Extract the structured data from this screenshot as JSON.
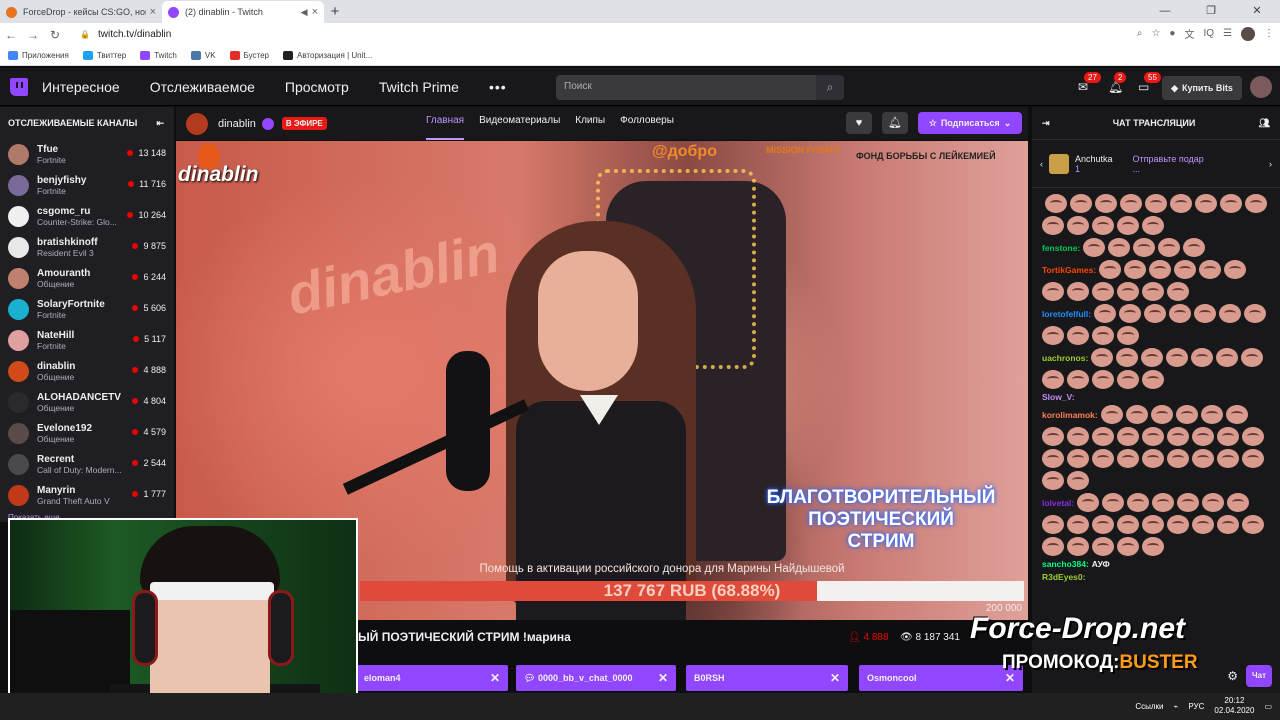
{
  "browser": {
    "tabs": [
      {
        "title": "ForceDrop - кейсы CS:GO, новы",
        "active": false,
        "color": "#e8731f"
      },
      {
        "title": "(2) dinablin - Twitch",
        "active": true,
        "color": "#9147ff"
      }
    ],
    "url": "twitch.tv/dinablin",
    "bookmarks": [
      {
        "label": "Приложения",
        "color": "#4285f4"
      },
      {
        "label": "Твиттер",
        "color": "#1da1f2"
      },
      {
        "label": "Twitch",
        "color": "#9147ff"
      },
      {
        "label": "VK",
        "color": "#4a76a8"
      },
      {
        "label": "Бустер",
        "color": "#e52d27"
      },
      {
        "label": "Авторизация | Unit...",
        "color": "#222222"
      }
    ]
  },
  "nav": {
    "links": [
      "Интересное",
      "Отслеживаемое",
      "Просмотр",
      "Twitch Prime"
    ],
    "search_placeholder": "Поиск",
    "badges": {
      "inbox": "27",
      "notifications": "2",
      "whispers": "55"
    },
    "bits_label": "Купить Bits"
  },
  "sidebar": {
    "title": "ОТСЛЕЖИВАЕМЫЕ КАНАЛЫ",
    "items": [
      {
        "name": "Tfue",
        "game": "Fortnite",
        "viewers": "13 148",
        "color": "#b07a6a"
      },
      {
        "name": "benjyfishy",
        "game": "Fortnite",
        "viewers": "11 716",
        "color": "#7a6a9a"
      },
      {
        "name": "csgomc_ru",
        "game": "Counter-Strike: Glo...",
        "viewers": "10 264",
        "color": "#f0f0f0"
      },
      {
        "name": "bratishkinoff",
        "game": "Resident Evil 3",
        "viewers": "9 875",
        "color": "#e8e8e8"
      },
      {
        "name": "Amouranth",
        "game": "Общение",
        "viewers": "6 244",
        "color": "#c08070"
      },
      {
        "name": "SolaryFortnite",
        "game": "Fortnite",
        "viewers": "5 606",
        "color": "#1ab0d0"
      },
      {
        "name": "NateHill",
        "game": "Fortnite",
        "viewers": "5 117",
        "color": "#e0a0a0"
      },
      {
        "name": "dinablin",
        "game": "Общение",
        "viewers": "4 888",
        "color": "#d04a1a"
      },
      {
        "name": "ALOHADANCETV",
        "game": "Общение",
        "viewers": "4 804",
        "color": "#2a2a2a"
      },
      {
        "name": "Evelone192",
        "game": "Общение",
        "viewers": "4 579",
        "color": "#5a4a4a"
      },
      {
        "name": "Recrent",
        "game": "Call of Duty: Modern...",
        "viewers": "2 544",
        "color": "#4a4a4a"
      },
      {
        "name": "Manyrin",
        "game": "Grand Theft Auto V",
        "viewers": "1 777",
        "color": "#c03a1a"
      }
    ],
    "more": "Показать еще"
  },
  "channel": {
    "name": "dinablin",
    "live_label": "В ЭФИРЕ",
    "tabs": [
      "Главная",
      "Видеоматериалы",
      "Клипы",
      "Фолловеры"
    ],
    "subscribe_label": "Подписаться"
  },
  "video": {
    "logo_text": "dinablin",
    "sponsor1": "@добро",
    "sponsor2": "MISSION POINTS",
    "sponsor3": "ФОНД БОРЬБЫ С ЛЕЙКЕМИЕЙ",
    "neon_text": "dinablin",
    "charity_lines": [
      "БЛАГОТВОРИТЕЛЬНЫЙ",
      "ПОЭТИЧЕСКИЙ",
      "СТРИМ"
    ],
    "help_text": "Помощь в активации российского донора для Марины Найдышевой",
    "raised": "137 767 RUB (68.88%)",
    "progress_fraction": 0.6888,
    "goal": "200 000"
  },
  "stream": {
    "title": "ЫЙ ПОЭТИЧЕСКИЙ СТРИМ !марина",
    "viewers": "4 888",
    "total_views": "8 187 341"
  },
  "tags": [
    "eloman4",
    "0000_bb_v_chat_0000",
    "B0RSH",
    "Osmoncool"
  ],
  "chat": {
    "title": "ЧАТ ТРАНСЛЯЦИИ",
    "gift_user": "Anchutka",
    "gift_count": "1",
    "gift_text": "Отправьте подар",
    "gift_more": "...",
    "messages": [
      {
        "user": "",
        "color": "#efeff1",
        "emotes": 14,
        "text": ""
      },
      {
        "user": "fenstone:",
        "color": "#00c853",
        "emotes": 5,
        "text": ""
      },
      {
        "user": "TortikGames:",
        "color": "#ff4500",
        "emotes": 12,
        "text": ""
      },
      {
        "user": "loretofelfull:",
        "color": "#1e90ff",
        "emotes": 11,
        "text": ""
      },
      {
        "user": "uachronos:",
        "color": "#9acd32",
        "emotes": 12,
        "text": ""
      },
      {
        "user": "Slow_V:",
        "color": "#c08ff0",
        "emotes": 0,
        "text": ""
      },
      {
        "user": "korolimamok:",
        "color": "#ff7f50",
        "emotes": 26,
        "text": ""
      },
      {
        "user": "lolvetal:",
        "color": "#8a2be2",
        "emotes": 21,
        "text": ""
      },
      {
        "user": "sancho384:",
        "color": "#00ff7f",
        "emotes": 0,
        "text": "АУФ"
      },
      {
        "user": "R3dEyes0:",
        "color": "#9acd32",
        "emotes": 0,
        "text": ""
      }
    ],
    "send_label": "Чат"
  },
  "promo": {
    "logo": "Force-Drop.net",
    "code_label": "ПРОМОКОД:",
    "code": "BUSTER"
  },
  "taskbar": {
    "links": "Ссылки",
    "lang": "РУС",
    "time": "20:12",
    "date": "02.04.2020"
  }
}
